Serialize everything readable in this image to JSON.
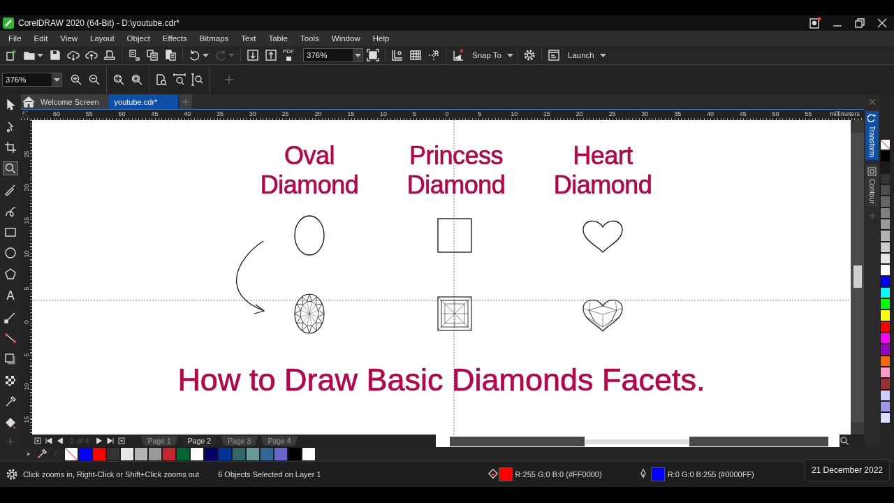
{
  "window": {
    "title": "CorelDRAW 2020 (64-Bit) - D:\\youtube.cdr*"
  },
  "menu": [
    "File",
    "Edit",
    "View",
    "Layout",
    "Object",
    "Effects",
    "Bitmaps",
    "Text",
    "Table",
    "Tools",
    "Window",
    "Help"
  ],
  "toolbar": {
    "redo": {
      "disabled": true
    },
    "pdf_label": "PDF",
    "zoom": "376%",
    "snap_to": "Snap To",
    "launch": "Launch"
  },
  "property_bar": {
    "zoom": "376%"
  },
  "toolbox": [
    {
      "selected": false
    },
    {
      "selected": false
    },
    {
      "selected": false
    },
    {
      "selected": true
    },
    {
      "selected": false
    },
    {
      "selected": false
    },
    {
      "selected": false
    },
    {
      "selected": false
    },
    {
      "selected": false
    },
    {
      "selected": false,
      "glyph": "A"
    },
    {
      "selected": false
    },
    {
      "selected": false
    },
    {
      "selected": false
    },
    {
      "selected": false
    },
    {
      "selected": false
    },
    {
      "selected": false
    }
  ],
  "tabs": [
    {
      "kind": "home",
      "label": "Welcome Screen",
      "selected": false
    },
    {
      "kind": "document",
      "label": "youtube.cdr*",
      "selected": true
    }
  ],
  "rulers": {
    "horizontal": [
      "60",
      "55",
      "50",
      "45",
      "40",
      "35",
      "30",
      "25",
      "20",
      "15",
      "10",
      "5",
      "0",
      "5",
      "10",
      "15",
      "20",
      "25",
      "30",
      "35",
      "40",
      "45",
      "50",
      "55"
    ],
    "units": "millimeters",
    "vertical": [
      "25",
      "20",
      "15",
      "10",
      "5",
      "0",
      "5",
      "10",
      "15"
    ]
  },
  "canvas": {
    "titles": [
      {
        "lines": [
          "Oval",
          "Diamond"
        ]
      },
      {
        "lines": [
          "Princess",
          "Diamond"
        ]
      },
      {
        "lines": [
          "Heart",
          "Diamond"
        ]
      }
    ],
    "heading": "How to Draw Basic Diamonds Facets."
  },
  "page_nav": {
    "counter": "2 of 4",
    "pages": [
      {
        "label": "Page 1",
        "selected": false
      },
      {
        "label": "Page 2",
        "selected": true
      },
      {
        "label": "Page 3",
        "selected": false
      },
      {
        "label": "Page 4",
        "selected": false
      }
    ]
  },
  "palette": [
    {
      "kind": "none"
    },
    {
      "kind": "color",
      "color": "#0000ff"
    },
    {
      "kind": "color",
      "color": "#ff0000"
    },
    {
      "kind": "color",
      "color": "#333333"
    },
    {
      "kind": "color",
      "color": "#e6e6e6"
    },
    {
      "kind": "color",
      "color": "#b3b3b3"
    },
    {
      "kind": "color",
      "color": "#999999"
    },
    {
      "kind": "color",
      "color": "#c1272d"
    },
    {
      "kind": "color",
      "color": "#006837"
    },
    {
      "kind": "color",
      "color": "#ffffff"
    },
    {
      "kind": "color",
      "color": "#000066"
    },
    {
      "kind": "color",
      "color": "#003399"
    },
    {
      "kind": "color",
      "color": "#336666"
    },
    {
      "kind": "color",
      "color": "#669999"
    },
    {
      "kind": "color",
      "color": "#336699"
    },
    {
      "kind": "color",
      "color": "#6666cc"
    },
    {
      "kind": "color",
      "color": "#000000"
    },
    {
      "kind": "color",
      "color": "#ffffff"
    }
  ],
  "docker": {
    "tabs": [
      {
        "label": "Transform",
        "selected": true
      },
      {
        "label": "Contour",
        "selected": false
      }
    ]
  },
  "right_palette": [
    {
      "kind": "none"
    },
    {
      "kind": "color",
      "color": "#000000"
    },
    {
      "kind": "color",
      "color": "#1a1a1a"
    },
    {
      "kind": "color",
      "color": "#333333"
    },
    {
      "kind": "color",
      "color": "#4d4d4d"
    },
    {
      "kind": "color",
      "color": "#666666"
    },
    {
      "kind": "color",
      "color": "#808080"
    },
    {
      "kind": "color",
      "color": "#999999"
    },
    {
      "kind": "color",
      "color": "#b3b3b3"
    },
    {
      "kind": "color",
      "color": "#cccccc"
    },
    {
      "kind": "color",
      "color": "#e6e6e6"
    },
    {
      "kind": "color",
      "color": "#ffffff"
    },
    {
      "kind": "color",
      "color": "#0000ff"
    },
    {
      "kind": "color",
      "color": "#00ffff"
    },
    {
      "kind": "color",
      "color": "#00ff00"
    },
    {
      "kind": "color",
      "color": "#ffff00"
    },
    {
      "kind": "color",
      "color": "#ff0000"
    },
    {
      "kind": "color",
      "color": "#ff00ff"
    },
    {
      "kind": "color",
      "color": "#9900cc"
    },
    {
      "kind": "color",
      "color": "#ff6600"
    },
    {
      "kind": "color",
      "color": "#ff99cc"
    },
    {
      "kind": "color",
      "color": "#993333"
    },
    {
      "kind": "color",
      "color": "#ccccff"
    },
    {
      "kind": "color",
      "color": "#9999ee"
    },
    {
      "kind": "color",
      "color": "#dcdcff"
    }
  ],
  "status_bar": {
    "hint": "Click zooms in, Right-Click or Shift+Click zooms out",
    "selection": "6 Objects Selected on Layer 1",
    "fill": {
      "text": "R:255 G:0 B:0 (#FF0000)",
      "color": "#ff0000"
    },
    "outline": {
      "text": "R:0 G:0 B:255 (#0000FF)",
      "color": "#0000ff"
    }
  },
  "tooltip": "21 December 2022"
}
